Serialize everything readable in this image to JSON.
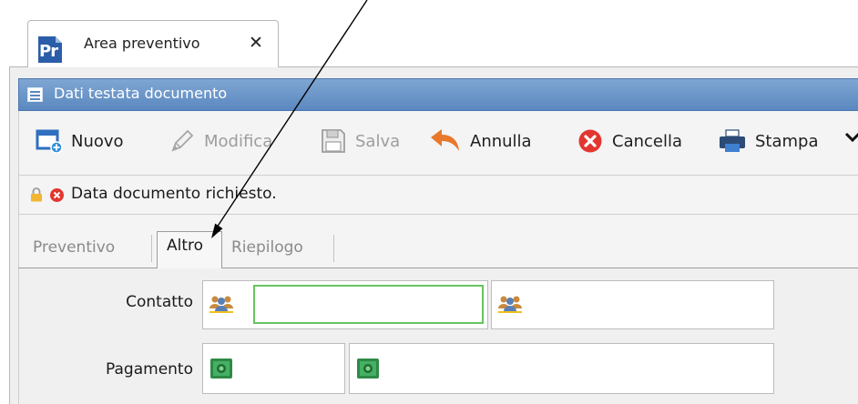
{
  "window": {
    "tab_title": "Area preventivo",
    "tab_icon_text": "Pr",
    "tab_close_glyph": "✕"
  },
  "section": {
    "title": "Dati testata documento"
  },
  "toolbar": {
    "buttons": [
      {
        "label": "Nuovo",
        "icon": "new-document-icon",
        "enabled": true
      },
      {
        "label": "Modifica",
        "icon": "pencil-icon",
        "enabled": false
      },
      {
        "label": "Salva",
        "icon": "floppy-disk-icon",
        "enabled": false
      },
      {
        "label": "Annulla",
        "icon": "undo-arrow-icon",
        "enabled": true
      },
      {
        "label": "Cancella",
        "icon": "red-x-circle-icon",
        "enabled": true
      },
      {
        "label": "Stampa",
        "icon": "printer-icon",
        "enabled": true
      }
    ],
    "more_glyph": "❯"
  },
  "status": {
    "message": "Data documento richiesto.",
    "icons": [
      "lock-icon",
      "error-icon"
    ]
  },
  "tabs": [
    {
      "label": "Preventivo",
      "active": false
    },
    {
      "label": "Altro",
      "active": true
    },
    {
      "label": "Riepilogo",
      "active": false
    }
  ],
  "form": {
    "contatto": {
      "label": "Contatto",
      "value": "",
      "icon": "contacts-people-icon"
    },
    "pagamento": {
      "label": "Pagamento",
      "icon": "money-banknote-icon"
    }
  },
  "colors": {
    "header_blue": "#5b88c0",
    "focus_green": "#67c55f",
    "accent_orange": "#e9782c",
    "error_red": "#e2362f"
  }
}
